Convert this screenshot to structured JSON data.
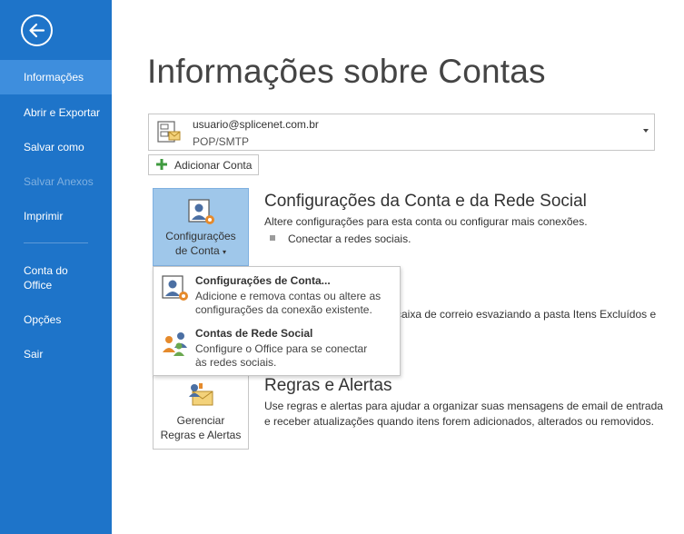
{
  "sidebar": {
    "items": [
      {
        "label": "Informações"
      },
      {
        "label": "Abrir e Exportar"
      },
      {
        "label": "Salvar como"
      },
      {
        "label": "Salvar Anexos"
      },
      {
        "label": "Imprimir"
      },
      {
        "label": "Conta do Office"
      },
      {
        "label": "Opções"
      },
      {
        "label": "Sair"
      }
    ]
  },
  "page": {
    "title": "Informações sobre Contas"
  },
  "account": {
    "email": "usuario@splicenet.com.br",
    "type": "POP/SMTP"
  },
  "add_account": {
    "label": "Adicionar Conta"
  },
  "account_settings": {
    "button_line1": "Configurações",
    "button_line2": "de Conta",
    "title": "Configurações da Conta e da Rede Social",
    "description": "Altere configurações para esta conta ou configurar mais conexões.",
    "bullet": "Conectar a redes sociais."
  },
  "cleanup": {
    "partial_text": "caixa de correio esvaziando a pasta Itens Excluídos e"
  },
  "rules": {
    "button_line1": "Gerenciar",
    "button_line2": "Regras e Alertas",
    "title": "Regras e Alertas",
    "description_line1": "Use regras e alertas para ajudar a organizar suas mensagens de email de entrada",
    "description_line2": "e receber atualizações quando itens forem adicionados, alterados ou removidos."
  },
  "dropdown_menu": {
    "items": [
      {
        "title": "Configurações de Conta...",
        "desc_line1": "Adicione e remova contas ou altere as",
        "desc_line2": "configurações da conexão existente."
      },
      {
        "title": "Contas de Rede Social",
        "desc_line1": "Configure o Office para se conectar",
        "desc_line2": "às redes sociais."
      }
    ]
  },
  "colors": {
    "sidebar": "#1e74c9",
    "sidebar_active": "#3e8edd",
    "pressed": "#9fc7ea"
  }
}
